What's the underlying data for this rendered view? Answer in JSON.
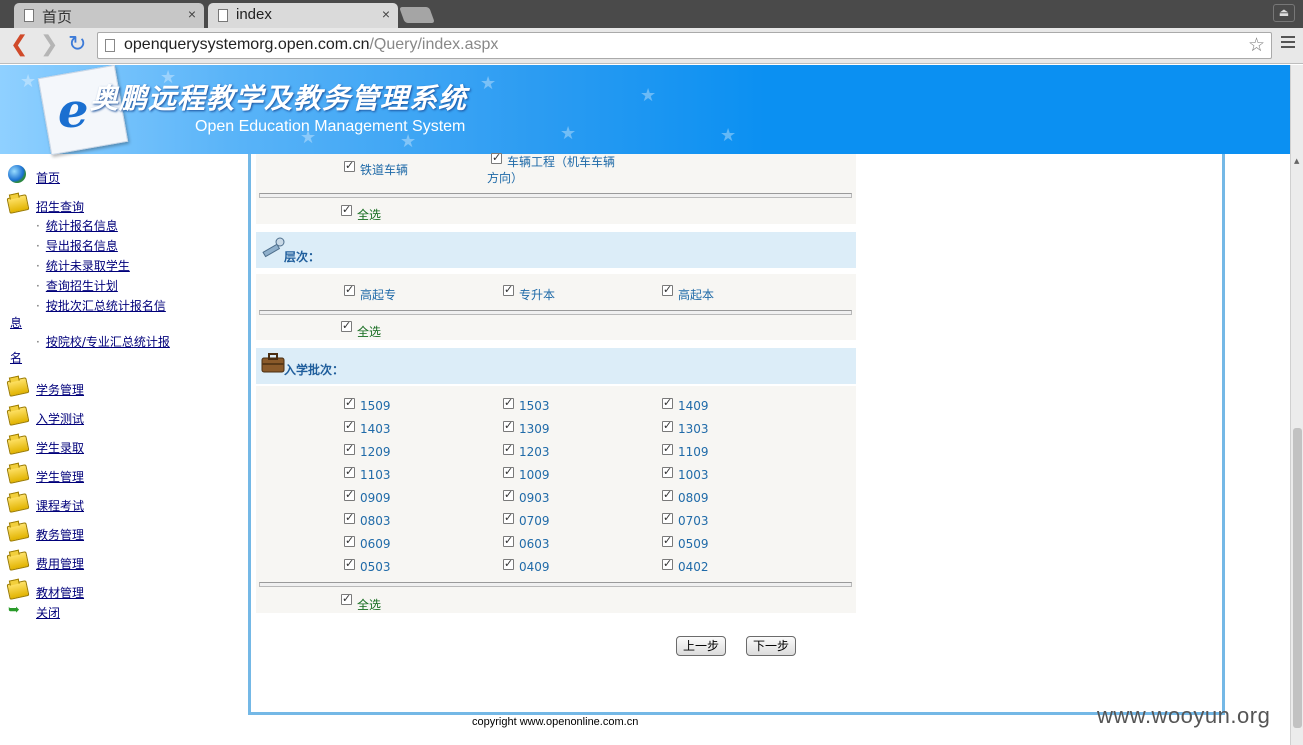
{
  "browser": {
    "tabs": [
      {
        "label": "首页",
        "active": false
      },
      {
        "label": "index",
        "active": true
      }
    ],
    "url_host": "openquerysystemorg.open.com.cn",
    "url_path": "/Query/index.aspx",
    "close_glyph": "×"
  },
  "banner": {
    "title": "奥鹏远程教学及教务管理系统",
    "subtitle": "Open Education Management System"
  },
  "leftnav": {
    "home": "首页",
    "enroll_query": "招生查询",
    "enroll_subitems": [
      "统计报名信息",
      "导出报名信息",
      "统计未录取学生",
      "查询招生计划",
      "按批次汇总统计报名信",
      "按院校/专业汇总统计报"
    ],
    "wrap_frag_1": "息",
    "wrap_frag_2": "名",
    "groups": [
      "学务管理",
      "入学测试",
      "学生录取",
      "学生管理",
      "课程考试",
      "教务管理",
      "费用管理",
      "教材管理"
    ],
    "close": "关闭"
  },
  "major_section": {
    "options": [
      "铁道车辆",
      "车辆工程（机车车辆",
      "方向）"
    ],
    "select_all": "全选"
  },
  "level_section": {
    "title": "层次：",
    "options": [
      "高起专",
      "专升本",
      "高起本"
    ],
    "select_all": "全选"
  },
  "batch_section": {
    "title": "入学批次：",
    "options": [
      "1509",
      "1503",
      "1409",
      "1403",
      "1309",
      "1303",
      "1209",
      "1203",
      "1109",
      "1103",
      "1009",
      "1003",
      "0909",
      "0903",
      "0809",
      "0803",
      "0709",
      "0703",
      "0609",
      "0603",
      "0509",
      "0503",
      "0409",
      "0402"
    ],
    "select_all": "全选"
  },
  "buttons": {
    "prev": "上一步",
    "next": "下一步"
  },
  "footer": {
    "copyright": "copyright www.openonline.com.cn",
    "watermark": "www.wooyun.org"
  }
}
